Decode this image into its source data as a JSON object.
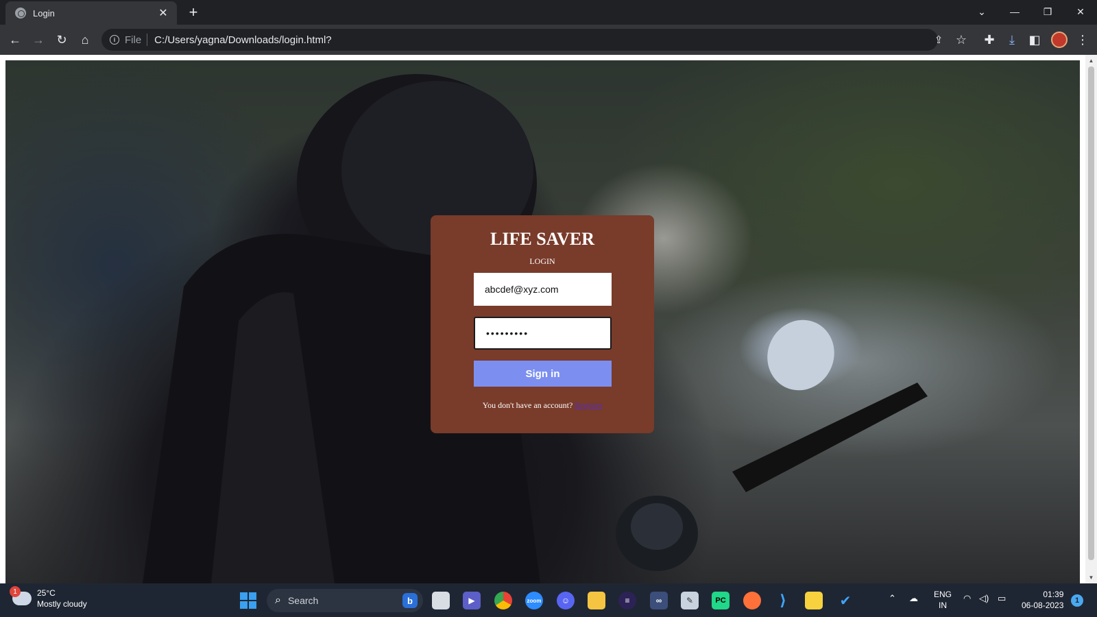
{
  "browser": {
    "tab_title": "Login",
    "tab_close": "✕",
    "new_tab": "+",
    "scheme_label": "File",
    "url": "C:/Users/yagna/Downloads/login.html?"
  },
  "login": {
    "brand": "LIFE SAVER",
    "subtitle": "LOGIN",
    "email_value": "abcdef@xyz.com",
    "password_value": "abcdefghi",
    "sign_in_label": "Sign in",
    "register_prompt": "You don't have an account?",
    "register_link": "Register"
  },
  "taskbar": {
    "weather_badge": "1",
    "temperature": "25°C",
    "condition": "Mostly cloudy",
    "search_label": "Search",
    "lang_top": "ENG",
    "lang_bottom": "IN",
    "time": "01:39",
    "date": "06-08-2023",
    "notification_count": "1",
    "pinned_apps": [
      "file-explorer",
      "meet",
      "chrome",
      "zoom",
      "discord",
      "folder",
      "eclipse",
      "vs",
      "notepad",
      "pycharm",
      "firefox",
      "vscode",
      "sticky-notes",
      "todo"
    ]
  },
  "colors": {
    "card_bg": "#793b2a",
    "sign_in_bg": "#7c8ff0",
    "register_link": "#5a2fb8"
  }
}
